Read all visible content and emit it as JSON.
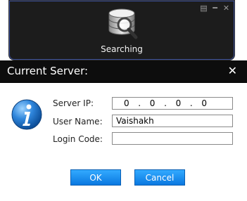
{
  "search_window": {
    "label": "Searching",
    "controls": [
      "menu-icon",
      "minimize-icon",
      "close-icon"
    ]
  },
  "dialog": {
    "title": "Current Server:",
    "close_glyph": "✕",
    "fields": {
      "server_ip_label": "Server IP:",
      "server_ip_octets": [
        "0",
        ".",
        "0",
        ".",
        "0",
        ".",
        "0"
      ],
      "user_name_label": "User Name:",
      "user_name_value": "Vaishakh",
      "login_code_label": "Login Code:",
      "login_code_value": ""
    },
    "buttons": {
      "ok": "OK",
      "cancel": "Cancel"
    }
  },
  "colors": {
    "accent_blue": "#1a8ef0",
    "title_bar": "#0d0d0d",
    "window_dark": "#1c1c1c"
  }
}
